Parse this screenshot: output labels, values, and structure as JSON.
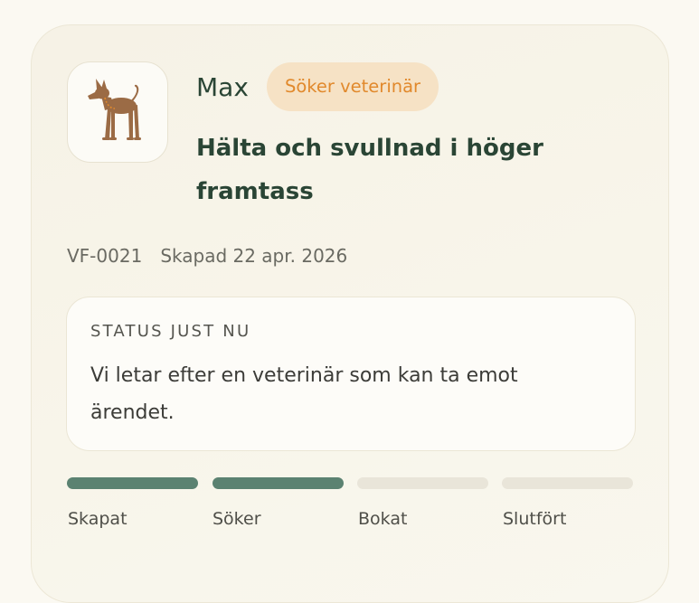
{
  "pet": {
    "name": "Max",
    "avatar_icon": "dog-icon"
  },
  "case": {
    "status_badge": "Söker veterinär",
    "title": "Hälta och svullnad i höger framtass",
    "id": "VF-0021",
    "created": "Skapad 22 apr. 2026"
  },
  "status_now": {
    "heading": "STATUS JUST NU",
    "text": "Vi letar efter en veterinär som kan ta emot ärendet."
  },
  "progress": {
    "current_step": 2,
    "steps": [
      {
        "label": "Skapat",
        "completed": true
      },
      {
        "label": "Söker",
        "completed": true
      },
      {
        "label": "Bokat",
        "completed": false
      },
      {
        "label": "Slutfört",
        "completed": false
      }
    ]
  },
  "colors": {
    "primary_text": "#2a4535",
    "badge_bg": "#f6e2c5",
    "badge_text": "#e1892c",
    "step_done": "#5b8271",
    "step_todo": "#e9e5d9",
    "dog": "#9b6b45"
  }
}
